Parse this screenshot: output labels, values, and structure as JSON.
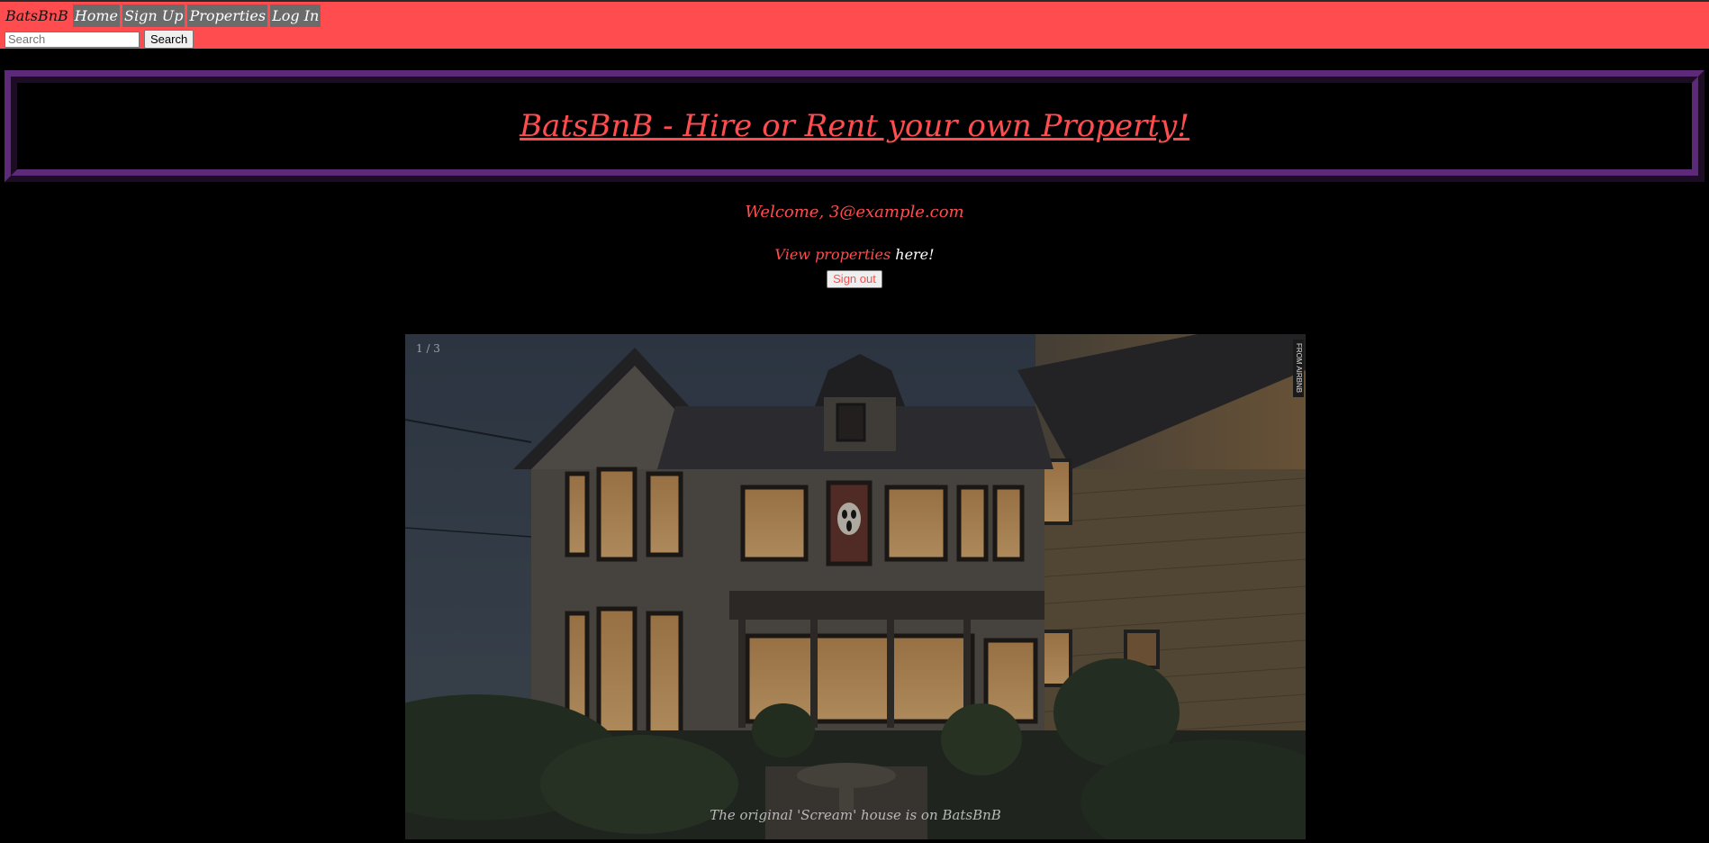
{
  "nav": {
    "brand": "BatsBnB",
    "items": [
      "Home",
      "Sign Up",
      "Properties",
      "Log In"
    ]
  },
  "search": {
    "placeholder": "Search",
    "button_label": "Search"
  },
  "hero": {
    "title": "BatsBnB - Hire or Rent your own Property!"
  },
  "welcome": {
    "text": "Welcome, 3@example.com"
  },
  "properties_link": {
    "link_text": "View properties",
    "suffix": " here!"
  },
  "signout": {
    "label": "Sign out"
  },
  "slideshow": {
    "counter": "1 / 3",
    "credit": "FROM AIRBNB",
    "caption": "The original 'Scream' house is on BatsBnB"
  },
  "colors": {
    "accent": "#ff4d4f",
    "frame": "#5d2a7a",
    "background": "#000000"
  }
}
